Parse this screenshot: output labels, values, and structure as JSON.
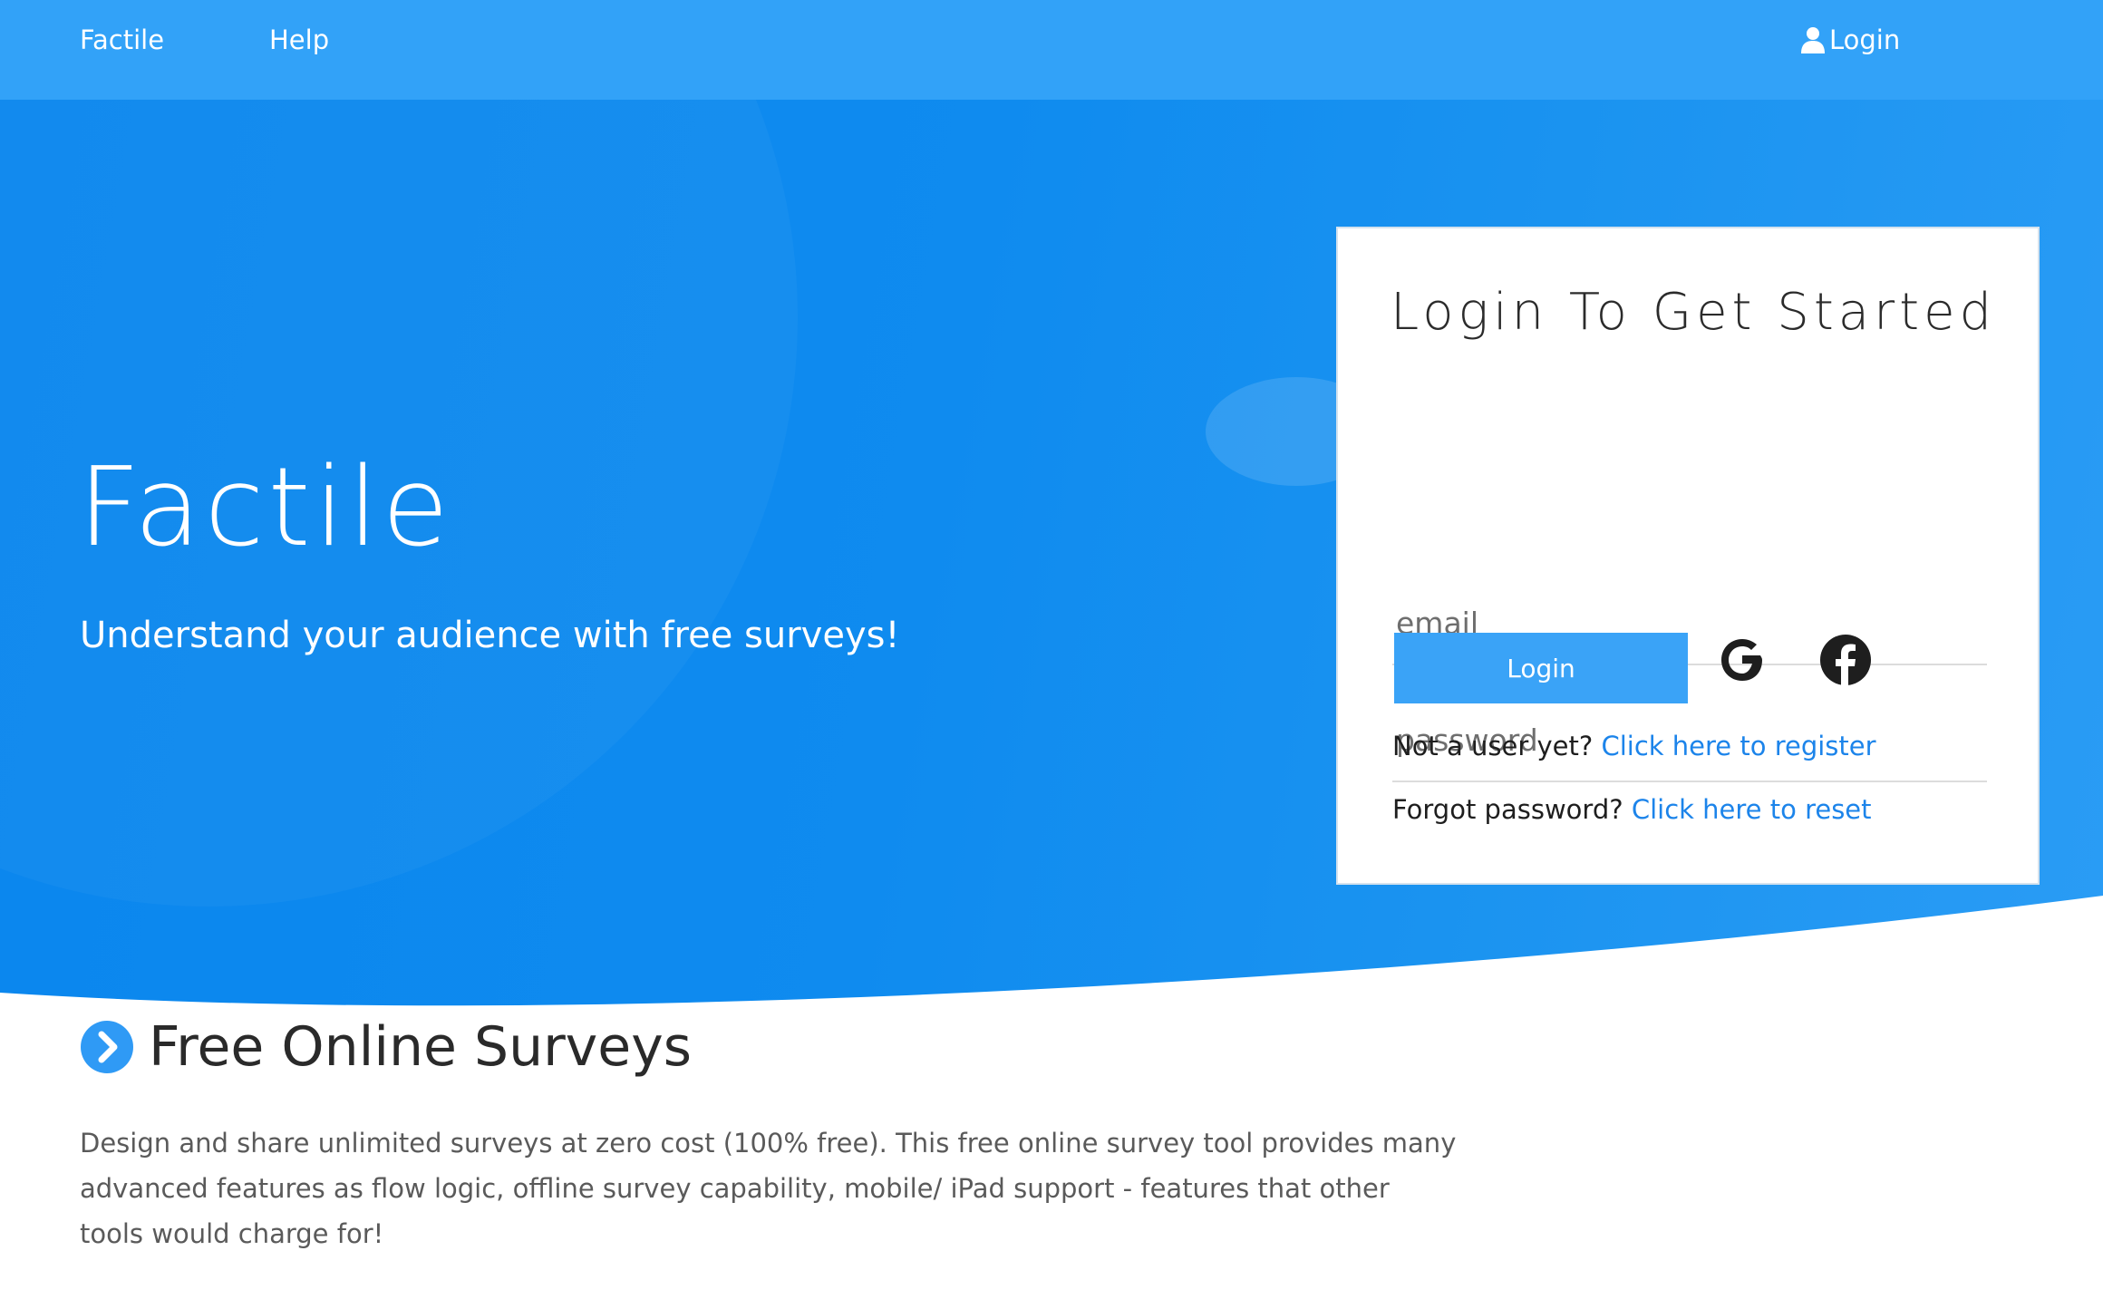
{
  "nav": {
    "brand": "Factile",
    "help": "Help",
    "login": "Login",
    "login_icon": "user-icon"
  },
  "hero": {
    "title": "Factile",
    "subtitle": "Understand your audience with free surveys!"
  },
  "login_card": {
    "title": "Login To Get Started",
    "email_placeholder": "email",
    "password_placeholder": "password",
    "login_button": "Login",
    "social_icons": [
      "google-icon",
      "facebook-icon"
    ],
    "register_prompt": "Not a user yet?",
    "register_link": "Click here to register",
    "forgot_prompt": "Forgot password?",
    "reset_link": "Click here to reset"
  },
  "section": {
    "icon": "chevron-right-icon",
    "title": "Free Online Surveys",
    "body": "Design and share unlimited surveys at zero cost (100% free). This free online survey tool provides many advanced features as flow logic, offline survey capability, mobile/ iPad support - features that other tools would charge for!"
  },
  "colors": {
    "navbar": "#32a2f8",
    "hero": "#0f8bef",
    "button": "#3aa3f7",
    "link": "#1c84ea"
  }
}
